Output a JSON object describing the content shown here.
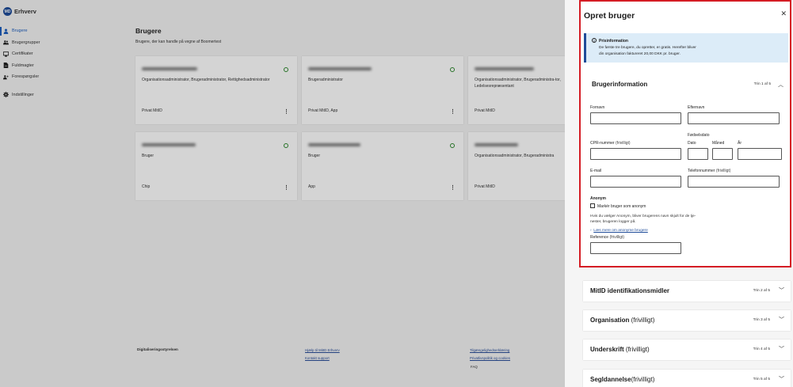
{
  "app": {
    "logo_badge": "MD",
    "logo_text": "Erhverv"
  },
  "sidebar": {
    "items": [
      {
        "label": "Brugere",
        "icon": "person-icon"
      },
      {
        "label": "Brugergrupper",
        "icon": "group-icon"
      },
      {
        "label": "Certifikater",
        "icon": "certificate-icon"
      },
      {
        "label": "Fuldmagter",
        "icon": "document-icon"
      },
      {
        "label": "Forespørgsler",
        "icon": "person-add-icon"
      },
      {
        "label": "Indstillinger",
        "icon": "gear-icon"
      }
    ]
  },
  "main": {
    "title": "Brugere",
    "subtitle": "Brugere, der kan handle på vegne af Boomertest",
    "cards": [
      {
        "roles": "Organisationsadministrator, Brugeradministrator, Rettighedsadministrator",
        "method": "Privat MitID"
      },
      {
        "roles": "Brugeradministrator",
        "method": "Privat MitID, App"
      },
      {
        "roles": "Organisationsadministrator, Brugeradministra-tor, Ledelsesrepræsentant",
        "method": "Privat MitID"
      },
      {
        "roles": "Bruger",
        "method": "Chip"
      },
      {
        "roles": "Bruger",
        "method": "App"
      },
      {
        "roles": "Organisationsadministrator, Brugeradministra",
        "method": "Privat MitID"
      }
    ]
  },
  "footer": {
    "org": "Digitaliseringsstyrelsen",
    "links_col1": [
      "Hjælp til MitID Erhverv",
      "Kontakt support"
    ],
    "links_col2": [
      "Tilgængelighedserklæring",
      "Privatlivspolitik og cookies"
    ],
    "faq": "FAQ"
  },
  "panel": {
    "title": "Opret bruger",
    "info": {
      "title": "Prisinformation",
      "body_line1": "De første tre brugere, du opretter, er gratis. Herefter bliver",
      "body_line2": "din organisation faktureret 20,00 DKK pr. bruger."
    },
    "section1": {
      "title": "Brugerinformation",
      "step": "Trin 1 af 5",
      "fornavn": "Fornavn",
      "efternavn": "Efternavn",
      "fodselsdato": "Fødselsdato",
      "cpr": "CPR-nummer",
      "cpr_opt": "(frivilligt)",
      "dato": "Dato",
      "maaned": "Måned",
      "aar": "År",
      "email": "E-mail",
      "telefon": "Telefonnummer",
      "telefon_opt": "(frivilligt)",
      "anonym": "Anonym",
      "anonym_checkbox": "Markér bruger som anonym",
      "help_line1": "Hvis du vælger Anonym, bliver brugerens navn skjult for de tje-",
      "help_line2": "nester, brugeren logger på.",
      "more_link": "Læs mere om anonyme brugere",
      "reference": "Reference",
      "reference_opt": "(frivilligt)"
    },
    "sections": [
      {
        "title": "MitID identifikationsmidler",
        "optional": "",
        "step": "Trin 2 af 5"
      },
      {
        "title": "Organisation",
        "optional": "(frivilligt)",
        "step": "Trin 3 af 5"
      },
      {
        "title": "Underskrift",
        "optional": "(frivilligt)",
        "step": "Trin 4 af 5"
      },
      {
        "title": "Segldannelse",
        "optional": "(frivilligt)",
        "step": "Trin 5 af 5"
      }
    ]
  },
  "colors": {
    "brand": "#1f4c99",
    "highlight_border": "#d51c24",
    "status_ok": "#2f8a2f",
    "info_bg": "#dcecf8"
  }
}
